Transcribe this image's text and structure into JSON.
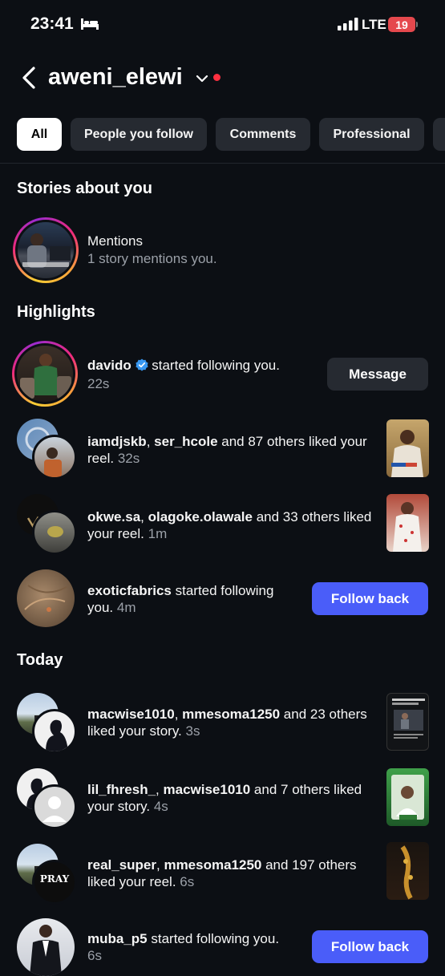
{
  "status": {
    "time": "23:41",
    "network": "LTE",
    "battery": "19"
  },
  "header": {
    "username": "aweni_elewi"
  },
  "filters": [
    "All",
    "People you follow",
    "Comments",
    "Professional"
  ],
  "sections": {
    "stories": "Stories about you",
    "highlights": "Highlights",
    "today": "Today"
  },
  "mentions": {
    "title": "Mentions",
    "subtitle": "1 story mentions you."
  },
  "notifications": [
    {
      "user": "davido",
      "text": " started following you.",
      "time": "22s",
      "button": "Message"
    },
    {
      "user": "iamdjskb",
      "user2": "ser_hcole",
      "text": " and 87 others liked your reel.",
      "time": "32s"
    },
    {
      "user": "okwe.sa",
      "user2": "olagoke.olawale",
      "text": " and 33 others liked your reel.",
      "time": "1m"
    },
    {
      "user": "exoticfabrics",
      "text": " started following you.",
      "time": "4m",
      "button": "Follow back"
    },
    {
      "user": "macwise1010",
      "user2": "mmesoma1250",
      "text": " and 23 others liked your story.",
      "time": "3s"
    },
    {
      "user": "lil_fhresh_",
      "user2": "macwise1010",
      "text": " and 7 others liked your story.",
      "time": "4s"
    },
    {
      "user": "real_super",
      "user2": "mmesoma1250",
      "text": " and 197 others liked your reel.",
      "time": "6s"
    },
    {
      "user": "muba_p5",
      "text": " started following you.",
      "time": "6s",
      "button": "Follow back"
    }
  ],
  "thumb_texts": {
    "pray": "PRAY"
  },
  "colors": {
    "accent": "#4a5df9",
    "background": "#0c0f14",
    "chip": "#262a31",
    "verified": "#3897f0",
    "notification_dot": "#ff3040"
  }
}
